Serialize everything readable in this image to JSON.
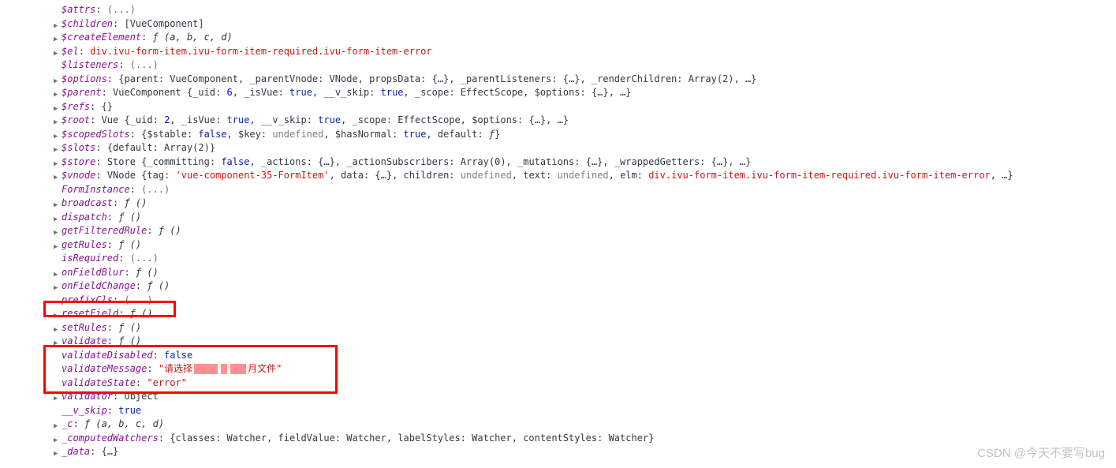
{
  "rows": [
    {
      "tri": false,
      "key": "$attrs",
      "val": "(...)",
      "cls": "dim"
    },
    {
      "tri": true,
      "key": "$children",
      "val": "[VueComponent]",
      "cls": "desc"
    },
    {
      "tri": true,
      "key": "$createElement",
      "val": "ƒ (a, b, c, d)",
      "cls": "func"
    },
    {
      "tri": true,
      "key": "$el",
      "val": "div.ivu-form-item.ivu-form-item-required.ivu-form-item-error",
      "cls": "str"
    },
    {
      "tri": false,
      "key": "$listeners",
      "val": "(...)",
      "cls": "dim"
    },
    {
      "tri": true,
      "key": "$options",
      "html": "{parent: VueComponent, _parentVnode: VNode, propsData: {…}, _parentListeners: {…}, _renderChildren: Array(2), …}"
    },
    {
      "tri": true,
      "key": "$parent",
      "html": "VueComponent {_uid: <span class=\"num\">6</span>, _isVue: <span class=\"bool\">true</span>, __v_skip: <span class=\"bool\">true</span>, _scope: EffectScope, $options: {…}, …}"
    },
    {
      "tri": true,
      "key": "$refs",
      "val": "{}",
      "cls": "desc"
    },
    {
      "tri": true,
      "key": "$root",
      "html": "Vue {_uid: <span class=\"num\">2</span>, _isVue: <span class=\"bool\">true</span>, __v_skip: <span class=\"bool\">true</span>, _scope: EffectScope, $options: {…}, …}"
    },
    {
      "tri": true,
      "key": "$scopedSlots",
      "html": "{$stable: <span class=\"bool\">false</span>, $key: <span class=\"undef\">undefined</span>, $hasNormal: <span class=\"bool\">true</span>, default: <span class=\"func\">ƒ</span>}"
    },
    {
      "tri": true,
      "key": "$slots",
      "val": "{default: Array(2)}",
      "cls": "desc"
    },
    {
      "tri": true,
      "key": "$store",
      "html": "Store {_committing: <span class=\"bool\">false</span>, _actions: {…}, _actionSubscribers: Array(0), _mutations: {…}, _wrappedGetters: {…}, …}"
    },
    {
      "tri": true,
      "key": "$vnode",
      "html": "VNode {tag: <span class=\"str\">'vue-component-35-FormItem'</span>, data: {…}, children: <span class=\"undef\">undefined</span>, text: <span class=\"undef\">undefined</span>, elm: <span class=\"str\">div.ivu-form-item.ivu-form-item-required.ivu-form-item-error</span>, …}"
    },
    {
      "tri": false,
      "key": "FormInstance",
      "val": "(...)",
      "cls": "dim"
    },
    {
      "tri": true,
      "key": "broadcast",
      "val": "ƒ ()",
      "cls": "func"
    },
    {
      "tri": true,
      "key": "dispatch",
      "val": "ƒ ()",
      "cls": "func"
    },
    {
      "tri": true,
      "key": "getFilteredRule",
      "val": "ƒ ()",
      "cls": "func"
    },
    {
      "tri": true,
      "key": "getRules",
      "val": "ƒ ()",
      "cls": "func"
    },
    {
      "tri": false,
      "key": "isRequired",
      "val": "(...)",
      "cls": "dim"
    },
    {
      "tri": true,
      "key": "onFieldBlur",
      "val": "ƒ ()",
      "cls": "func"
    },
    {
      "tri": true,
      "key": "onFieldChange",
      "val": "ƒ ()",
      "cls": "func"
    },
    {
      "tri": false,
      "key": "prefixCls",
      "val": "(...)",
      "cls": "dim"
    },
    {
      "tri": true,
      "key": "resetField",
      "val": "ƒ ()",
      "cls": "func"
    },
    {
      "tri": true,
      "key": "setRules",
      "val": "ƒ ()",
      "cls": "func"
    },
    {
      "tri": true,
      "key": "validate",
      "val": "ƒ ()",
      "cls": "func"
    },
    {
      "tri": false,
      "key": "validateDisabled",
      "val": "false",
      "cls": "bool"
    },
    {
      "tri": false,
      "key": "validateMessage",
      "html": "<span class=\"str\">\"请选择<span class=\"redact1\"></span><span class=\"redact2\"></span><span class=\"redact3\"></span>月文件\"</span>"
    },
    {
      "tri": false,
      "key": "validateState",
      "val": "\"error\"",
      "cls": "str"
    },
    {
      "tri": true,
      "key": "validator",
      "val": "Object",
      "cls": "desc"
    },
    {
      "tri": false,
      "key": "__v_skip",
      "val": "true",
      "cls": "bool"
    },
    {
      "tri": true,
      "key": "_c",
      "val": "ƒ (a, b, c, d)",
      "cls": "func"
    },
    {
      "tri": true,
      "key": "_computedWatchers",
      "html": "{classes: Watcher, fieldValue: Watcher, labelStyles: Watcher, contentStyles: Watcher}"
    },
    {
      "tri": true,
      "key": "_data",
      "val": "{…}",
      "cls": "desc"
    }
  ],
  "watermark": "CSDN @今天不要写bug"
}
